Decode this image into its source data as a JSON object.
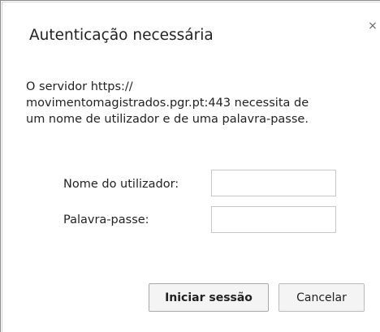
{
  "dialog": {
    "title": "Autenticação necessária",
    "close_glyph": "×",
    "message_lines": [
      "O servidor https://",
      "movimentomagistrados.pgr.pt:443 necessita de",
      "um nome de utilizador e de uma palavra-passe."
    ],
    "username_label": "Nome do utilizador:",
    "username_value": "",
    "password_label": "Palavra-passe:",
    "password_value": "",
    "login_button": "Iniciar sessão",
    "cancel_button": "Cancelar"
  },
  "icons": {
    "close": "close-icon"
  }
}
